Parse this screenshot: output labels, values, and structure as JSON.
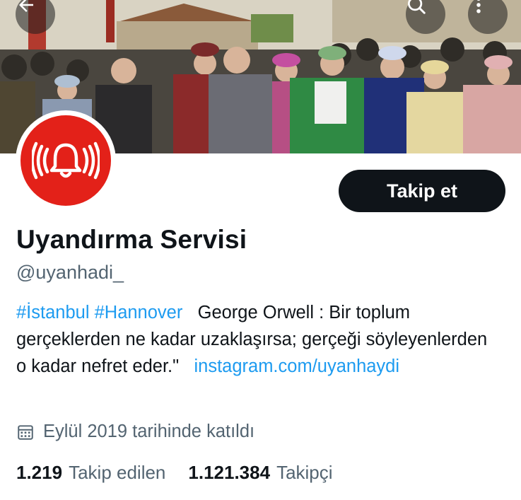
{
  "header": {
    "back_icon": "back-arrow-icon",
    "search_icon": "search-icon",
    "more_icon": "more-vertical-icon"
  },
  "banner": {
    "description_icon": "crowd-photo"
  },
  "profile": {
    "avatar_icon": "alarm-bell-signal-icon",
    "avatar_color": "#e32119",
    "follow_label": "Takip et",
    "display_name": "Uyandırma Servisi",
    "handle": "@uyanhadi_",
    "bio": {
      "hashtag1": "#İstanbul",
      "hashtag2": "#Hannover",
      "text": "George Orwell : Bir toplum gerçeklerden ne kadar uzaklaşırsa; gerçeği söyleyenlerden o kadar nefret eder.\"",
      "link": "instagram.com/uyanhaydi"
    },
    "joined": "Eylül 2019 tarihinde katıldı",
    "following_count": "1.219",
    "following_label": "Takip edilen",
    "followers_count": "1.121.384",
    "followers_label": "Takipçi"
  },
  "colors": {
    "link": "#1d9bf0",
    "text": "#0f1419",
    "secondary": "#536471",
    "button": "#0f1419"
  }
}
